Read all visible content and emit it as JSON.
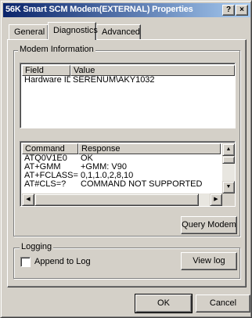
{
  "window": {
    "title": "56K Smart SCM Modem(EXTERNAL) Properties",
    "help_button": "?",
    "close_button": "×"
  },
  "tabs": [
    {
      "label": "General",
      "active": false
    },
    {
      "label": "Diagnostics",
      "active": true
    },
    {
      "label": "Advanced",
      "active": false
    }
  ],
  "modem_info": {
    "group_label": "Modem Information",
    "columns": [
      "Field",
      "Value"
    ],
    "rows": [
      {
        "field": "Hardware ID",
        "value": "SERENUM\\AKY1032"
      }
    ]
  },
  "responses": {
    "columns": [
      "Command",
      "Response"
    ],
    "rows": [
      {
        "command": "ATQ0V1E0",
        "response": "OK"
      },
      {
        "command": "AT+GMM",
        "response": "+GMM: V90"
      },
      {
        "command": "AT+FCLASS=?",
        "response": "0,1,1.0,2,8,10"
      },
      {
        "command": "AT#CLS=?",
        "response": "COMMAND NOT SUPPORTED"
      }
    ]
  },
  "query_button": "Query Modem",
  "logging": {
    "group_label": "Logging",
    "append_label": "Append to Log",
    "append_checked": false,
    "view_log_button": "View log"
  },
  "footer": {
    "ok_button": "OK",
    "cancel_button": "Cancel"
  },
  "colors": {
    "titlebar_start": "#0a246a",
    "titlebar_end": "#a6caf0",
    "face": "#d4d0c8"
  }
}
